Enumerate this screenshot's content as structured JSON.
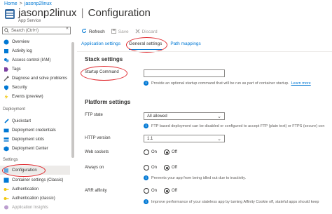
{
  "breadcrumb": {
    "home": "Home",
    "sep": ">",
    "current": "jasonp2linux"
  },
  "header": {
    "resource": "jasonp2linux",
    "divider": "|",
    "page": "Configuration",
    "type": "App Service"
  },
  "sidebar": {
    "search_placeholder": "Search (Ctrl+/)",
    "collapse": "«",
    "items": [
      {
        "label": "Overview",
        "icon": "globe-icon"
      },
      {
        "label": "Activity log",
        "icon": "activity-log-icon"
      },
      {
        "label": "Access control (IAM)",
        "icon": "people-icon"
      },
      {
        "label": "Tags",
        "icon": "tag-icon"
      },
      {
        "label": "Diagnose and solve problems",
        "icon": "wrench-icon"
      },
      {
        "label": "Security",
        "icon": "shield-icon"
      },
      {
        "label": "Events (preview)",
        "icon": "lightning-icon"
      }
    ],
    "deployment_header": "Deployment",
    "deployment_items": [
      {
        "label": "Quickstart",
        "icon": "rocket-icon"
      },
      {
        "label": "Deployment credentials",
        "icon": "credentials-icon"
      },
      {
        "label": "Deployment slots",
        "icon": "slots-icon"
      },
      {
        "label": "Deployment Center",
        "icon": "cube-icon"
      }
    ],
    "settings_header": "Settings",
    "settings_items": [
      {
        "label": "Configuration",
        "icon": "config-icon",
        "active": true
      },
      {
        "label": "Container settings (Classic)",
        "icon": "container-icon"
      },
      {
        "label": "Authentication",
        "icon": "key-icon"
      },
      {
        "label": "Authentication (classic)",
        "icon": "key-icon"
      },
      {
        "label": "Application Insights",
        "icon": "insights-icon"
      }
    ]
  },
  "toolbar": {
    "refresh": "Refresh",
    "save": "Save",
    "discard": "Discard"
  },
  "tabs": [
    "Application settings",
    "General settings",
    "Path mappings"
  ],
  "stack": {
    "heading": "Stack settings",
    "startup_label": "Startup Command",
    "startup_value": "",
    "startup_info": "Provide an optional startup command that will be run as part of container startup.",
    "learn_more": "Learn more"
  },
  "platform": {
    "heading": "Platform settings",
    "ftp_label": "FTP state",
    "ftp_value": "All allowed",
    "ftp_info": "FTP based deployment can be disabled or configured to accept FTP (plain text) or FTPS (secure) con",
    "http_label": "HTTP version",
    "http_value": "1.1",
    "ws_label": "Web sockets",
    "ws_value": "Off",
    "always_label": "Always on",
    "always_value": "Off",
    "always_info": "Prevents your app from being idled out due to inactivity.",
    "arr_label": "ARR affinity",
    "arr_value": "Off",
    "arr_info": "Improve performance of your stateless app by turning Affinity Cookie off, stateful apps should keep"
  },
  "radio_on": "On",
  "radio_off": "Off",
  "colors": {
    "accent": "#0078d4",
    "annotation": "#e0282e"
  }
}
